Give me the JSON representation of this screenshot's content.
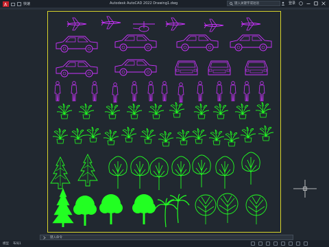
{
  "app": {
    "window_title": "Autodesk AutoCAD 2022   Drawing1.dwg",
    "menu_label": "快速",
    "search_placeholder": "键入关键字或短语",
    "user_label": "登录"
  },
  "command": {
    "prompt": "键入命令"
  },
  "layout_tabs": [
    "模型",
    "布局1"
  ],
  "colors": {
    "background": "#212830",
    "frame": "#d8d52c",
    "vehicles_people": "#cc33ff",
    "plants": "#22ff22"
  },
  "icons": [
    "autocad-logo-icon",
    "open-icon",
    "save-icon",
    "search-icon",
    "user-icon",
    "help-icon",
    "minimize-icon",
    "maximize-icon",
    "close-icon",
    "command-icon",
    "crosshair-cursor-icon"
  ]
}
